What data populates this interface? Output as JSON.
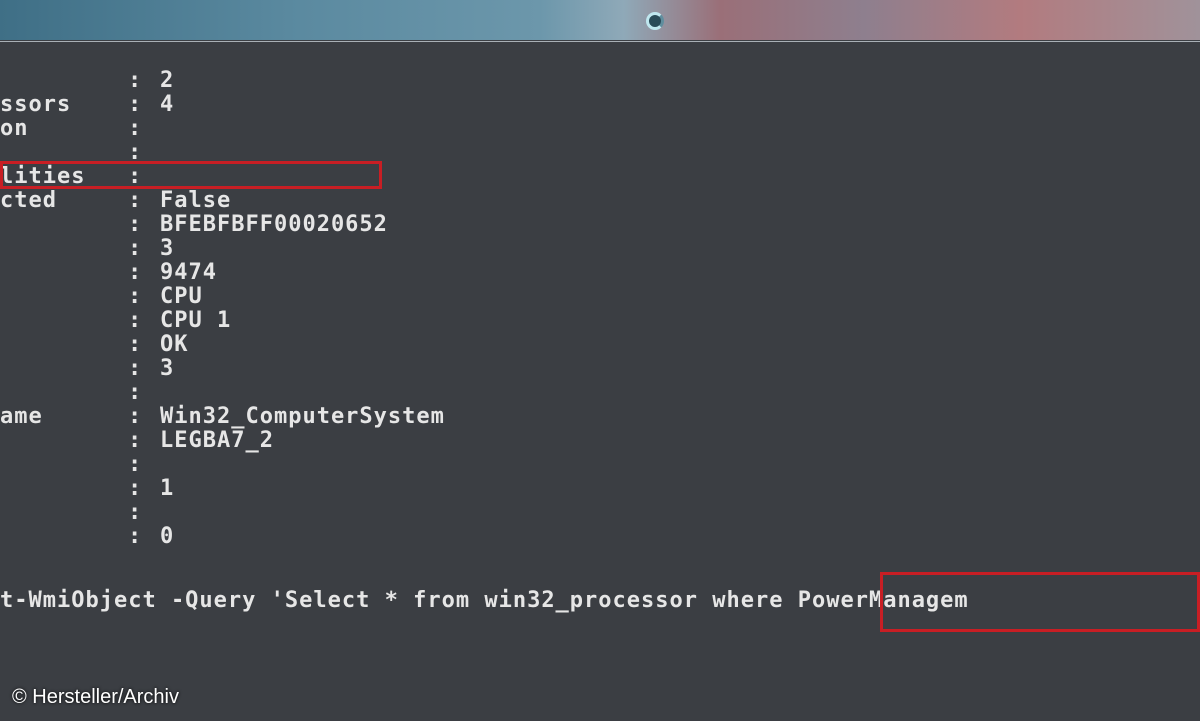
{
  "rows": [
    {
      "label": "",
      "value": "2"
    },
    {
      "label": "ssors",
      "value": "4"
    },
    {
      "label": "on",
      "value": ""
    },
    {
      "label": "",
      "value": ""
    },
    {
      "label": "lities",
      "value": ""
    },
    {
      "label": "cted",
      "value": "False"
    },
    {
      "label": "",
      "value": "BFEBFBFF00020652"
    },
    {
      "label": "",
      "value": "3"
    },
    {
      "label": "",
      "value": "9474"
    },
    {
      "label": "",
      "value": "CPU"
    },
    {
      "label": "",
      "value": "CPU 1"
    },
    {
      "label": "",
      "value": "OK"
    },
    {
      "label": "",
      "value": "3"
    },
    {
      "label": "",
      "value": ""
    },
    {
      "label": "ame",
      "value": "Win32_ComputerSystem"
    },
    {
      "label": "",
      "value": "LEGBA7_2"
    },
    {
      "label": "",
      "value": ""
    },
    {
      "label": "",
      "value": "1"
    },
    {
      "label": "",
      "value": ""
    },
    {
      "label": "",
      "value": "0"
    }
  ],
  "colon": ":",
  "command": "t-WmiObject -Query 'Select * from win32_processor where PowerManagem",
  "credit": "© Hersteller/Archiv"
}
